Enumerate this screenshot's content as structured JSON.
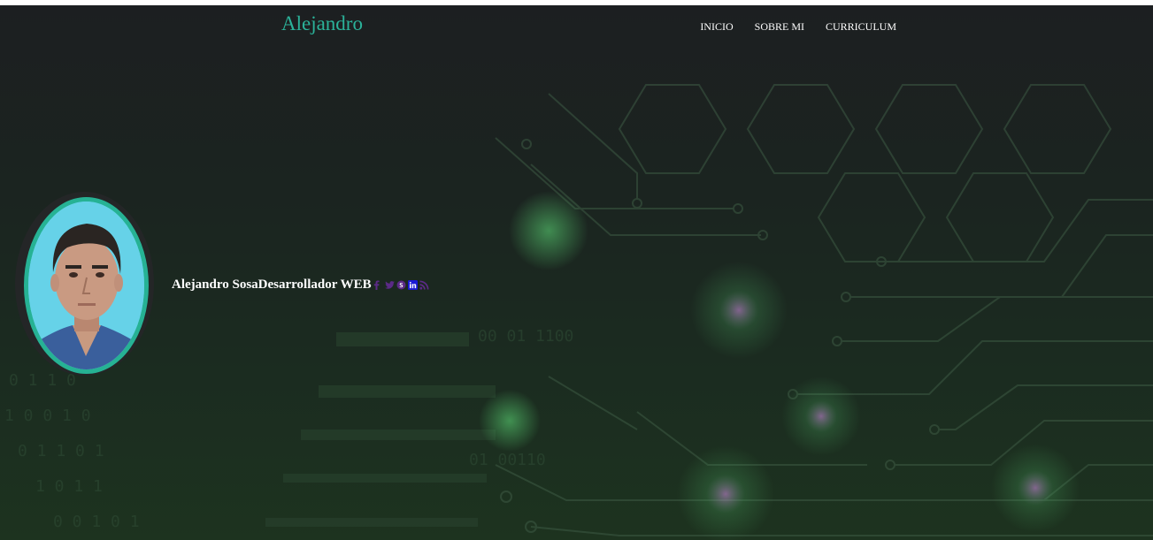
{
  "navbar": {
    "brand": "Alejandro",
    "links": [
      "INICIO",
      "SOBRE MI",
      "CURRICULUM"
    ],
    "accent_color": "#2bb39a"
  },
  "hero": {
    "name": "Alejandro Sosa",
    "role": "Desarrollador WEB",
    "avatar_border_color": "#26b294",
    "social_icons": [
      {
        "name": "facebook-icon",
        "color": "#5b2a86"
      },
      {
        "name": "twitter-icon",
        "color": "#5b2a86"
      },
      {
        "name": "skype-icon",
        "color": "#5b2a86"
      },
      {
        "name": "linkedin-icon",
        "color": "#1a1ad6"
      },
      {
        "name": "rss-icon",
        "color": "#5b2a86"
      }
    ]
  }
}
